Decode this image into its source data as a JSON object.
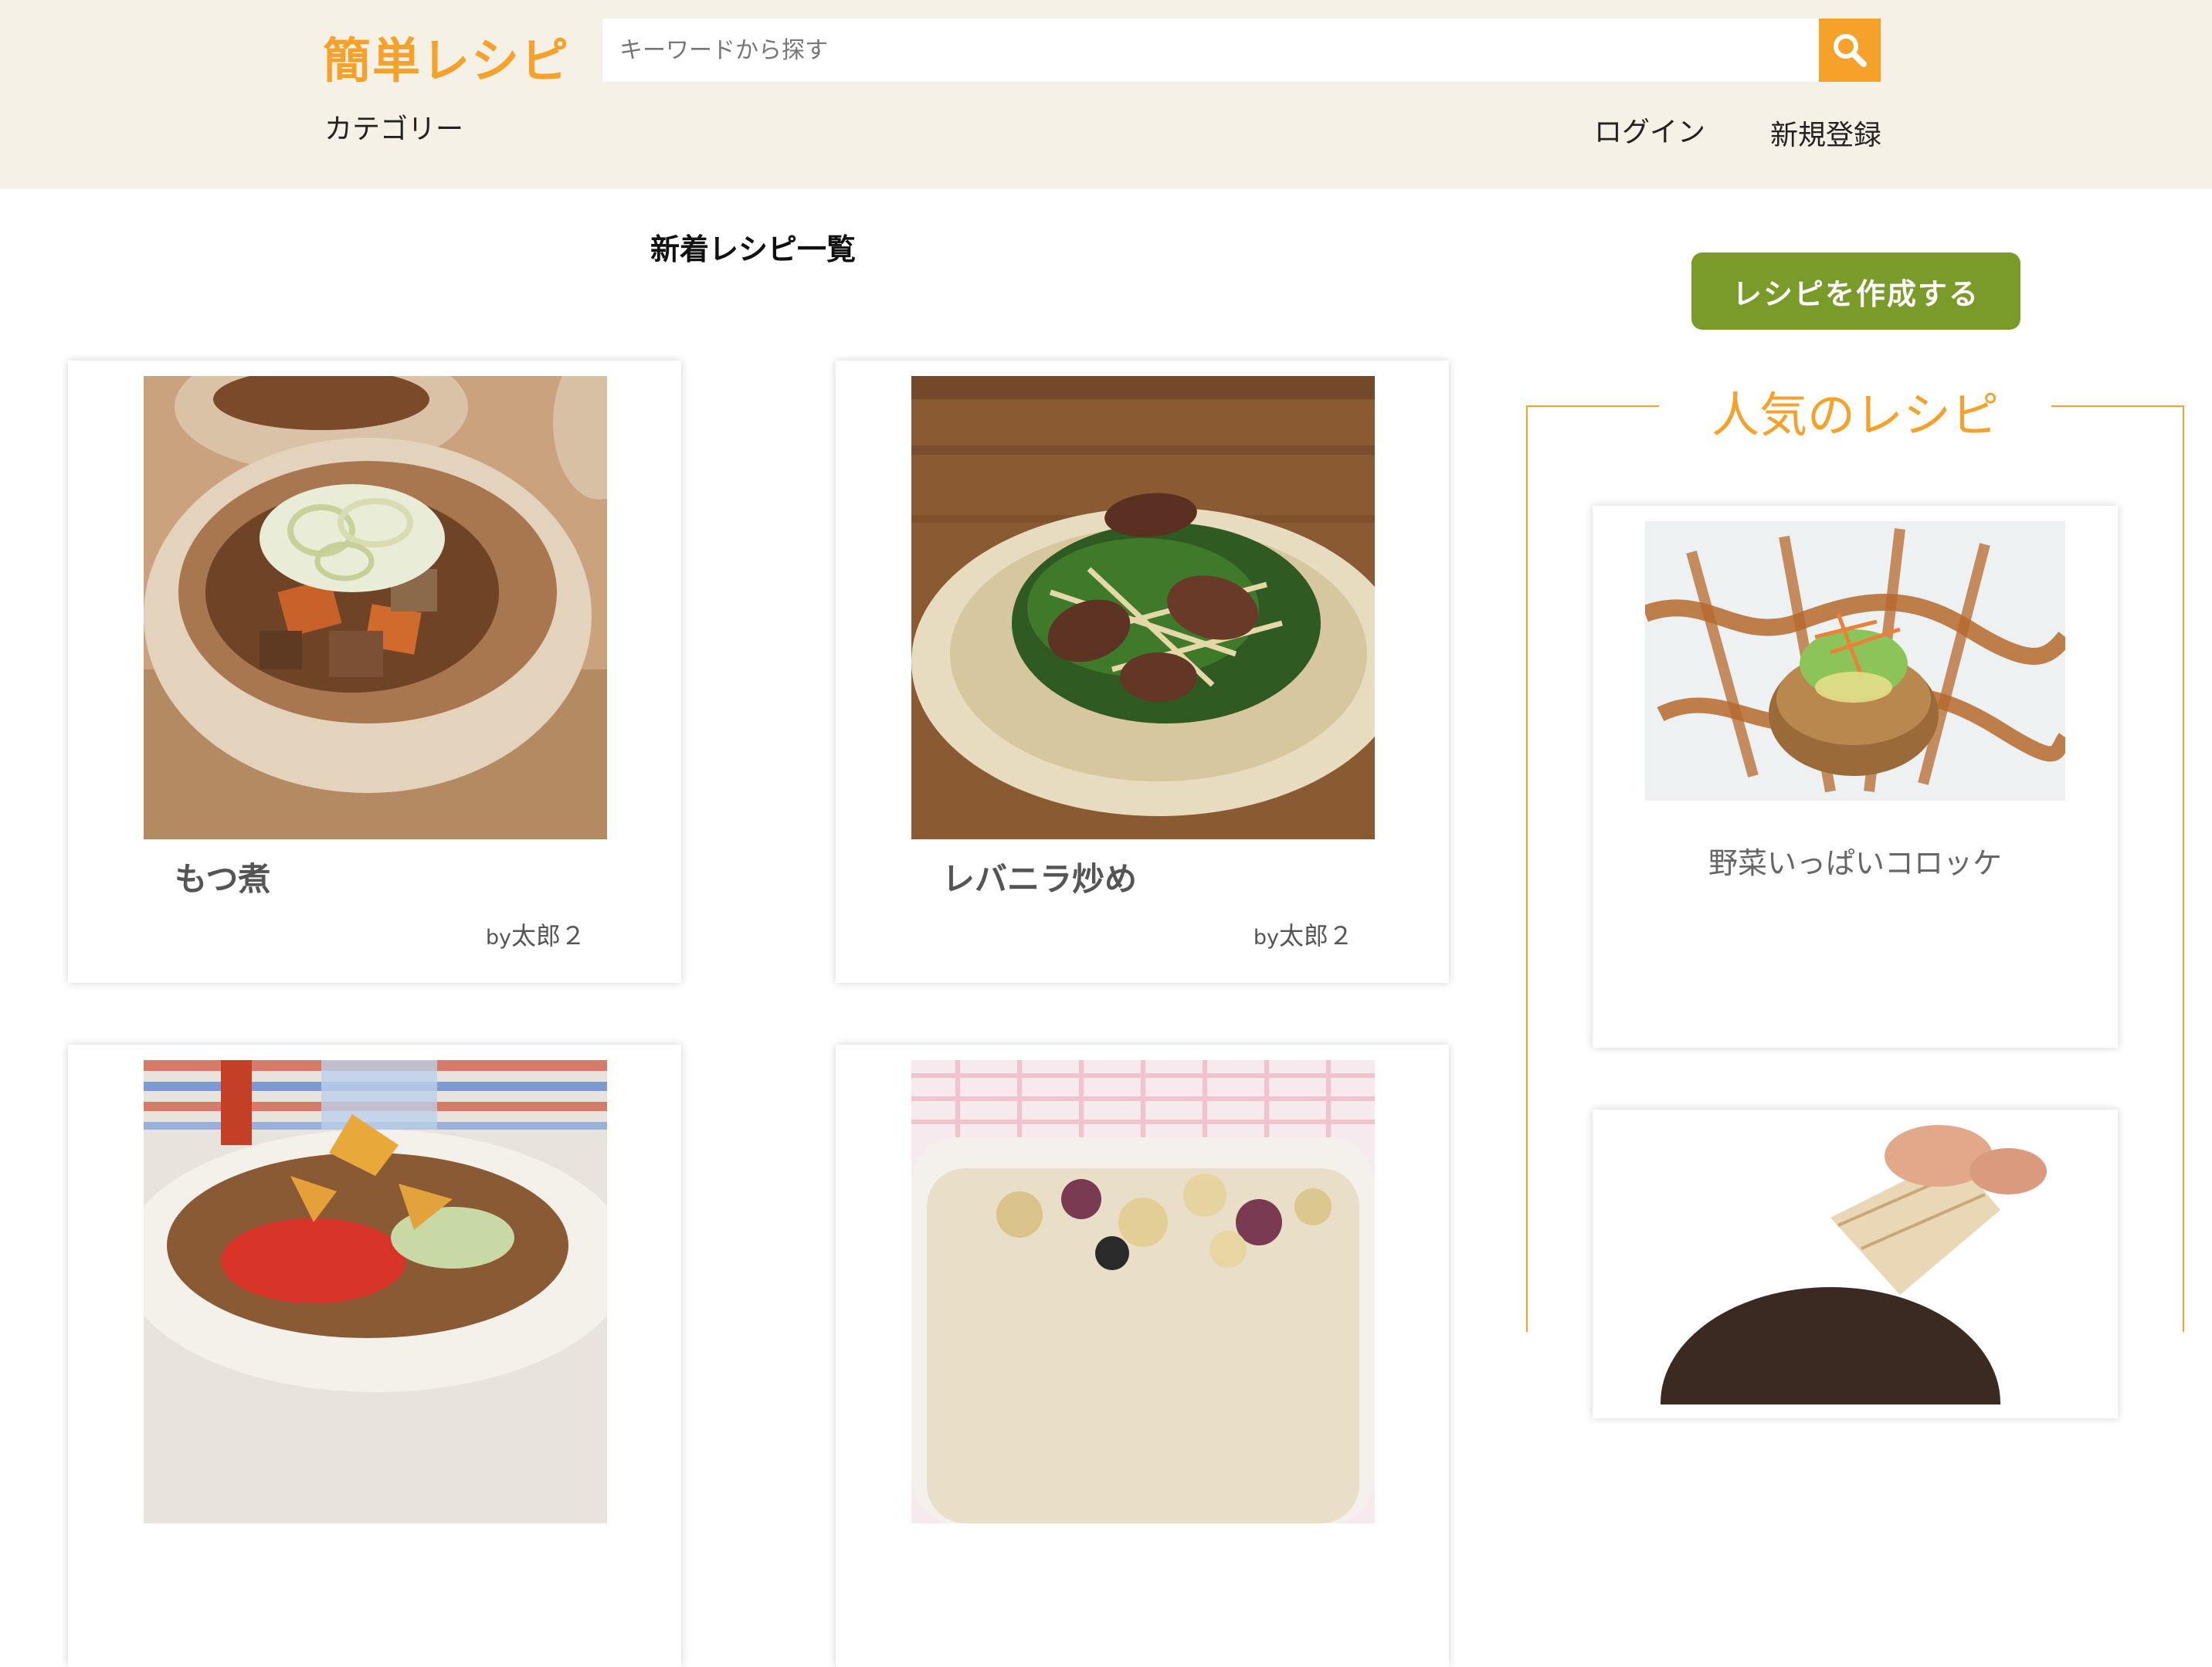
{
  "header": {
    "logo": "簡単レシピ",
    "search_placeholder": "キーワードから探す",
    "nav": {
      "category": "カテゴリー",
      "login": "ログイン",
      "signup": "新規登録"
    }
  },
  "main": {
    "section_title": "新着レシピ一覧",
    "recipes": [
      {
        "title": "もつ煮",
        "author_prefix": "by",
        "author": "太郎２"
      },
      {
        "title": "レバニラ炒め",
        "author_prefix": "by",
        "author": "太郎２"
      },
      {
        "title": "",
        "author_prefix": "",
        "author": ""
      },
      {
        "title": "",
        "author_prefix": "",
        "author": ""
      }
    ]
  },
  "sidebar": {
    "create_button": "レシピを作成する",
    "popular_heading": "人気のレシピ",
    "popular": [
      {
        "title": "野菜いっぱいコロッケ"
      },
      {
        "title": ""
      }
    ]
  },
  "colors": {
    "accent": "#f5a12a",
    "header_bg": "#f6f1e7",
    "create_button_bg": "#7a9a2a"
  },
  "icons": {
    "search": "search-icon"
  }
}
